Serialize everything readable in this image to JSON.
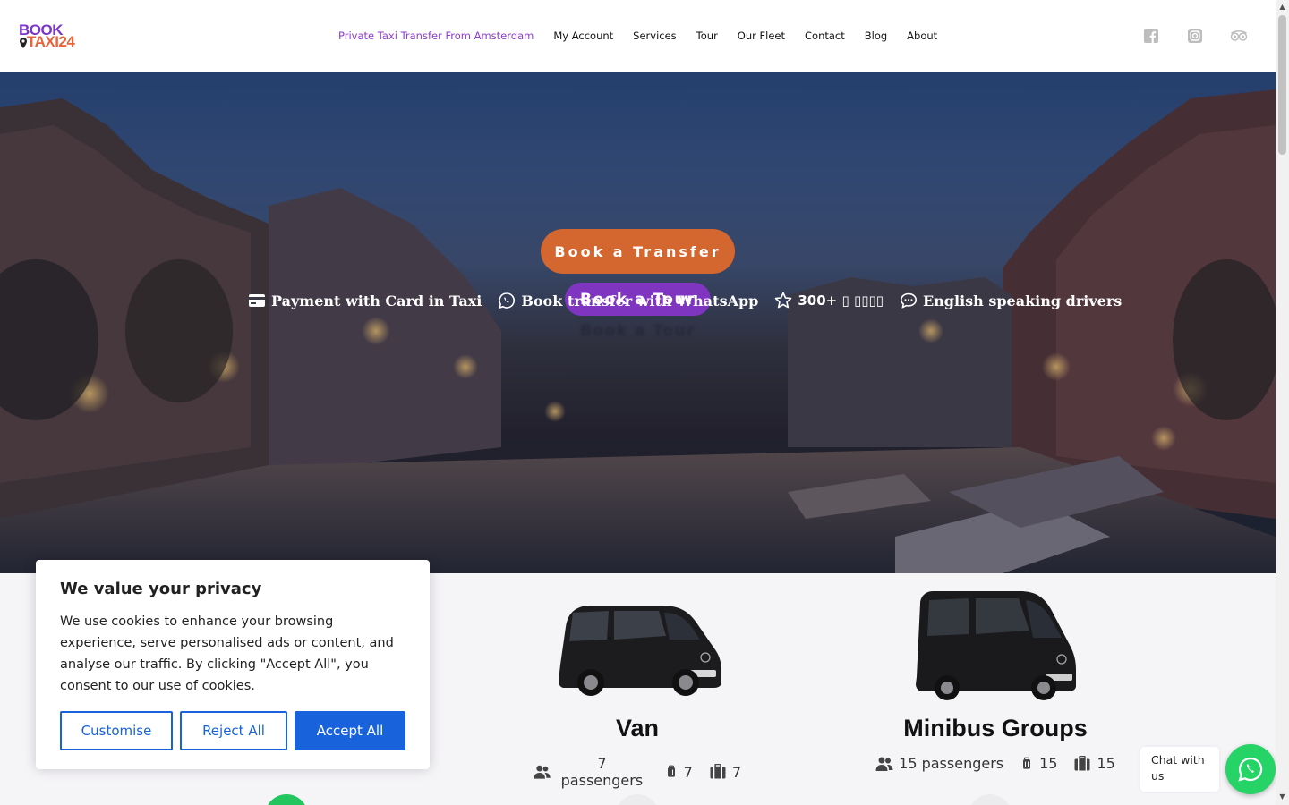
{
  "header": {
    "logo": {
      "line1": "BOOK",
      "line2": "TAXI24"
    },
    "nav": [
      {
        "label": "Private Taxi Transfer From Amsterdam",
        "active": true
      },
      {
        "label": "My Account"
      },
      {
        "label": "Services"
      },
      {
        "label": "Tour"
      },
      {
        "label": "Our Fleet"
      },
      {
        "label": "Contact"
      },
      {
        "label": "Blog"
      },
      {
        "label": "About"
      }
    ],
    "social_icons": [
      "facebook-icon",
      "instagram-icon",
      "tripadvisor-icon"
    ]
  },
  "hero": {
    "book_transfer_label": "Book a Transfer",
    "book_tour_label": "Book a Tour",
    "features": [
      {
        "icon": "credit-card-icon",
        "text": "Payment with Card in Taxi"
      },
      {
        "icon": "whatsapp-icon",
        "text": "Book transfer with WhatsApp"
      },
      {
        "icon": "star-icon",
        "text": "300+ ▯ ▯▯▯▯"
      },
      {
        "icon": "chat-bubble-icon",
        "text": "English speaking drivers"
      }
    ]
  },
  "fleet": [
    {
      "name": "Van",
      "passengers": "7 passengers",
      "suitcases": "7",
      "bags": "7"
    },
    {
      "name": "Minibus Groups",
      "passengers": "15 passengers",
      "suitcases": "15",
      "bags": "15"
    }
  ],
  "cookie": {
    "title": "We value your privacy",
    "text": "We use cookies to enhance your browsing experience, serve personalised ads or content, and analyse our traffic. By clicking \"Accept All\", you consent to our use of cookies.",
    "customise_label": "Customise",
    "reject_label": "Reject All",
    "accept_label": "Accept All"
  },
  "chat": {
    "label": "Chat with us"
  },
  "colors": {
    "brand_purple": "#7f35c0",
    "brand_orange": "#d4662f",
    "cookie_blue": "#1863dc",
    "whatsapp_green": "#25d366"
  }
}
